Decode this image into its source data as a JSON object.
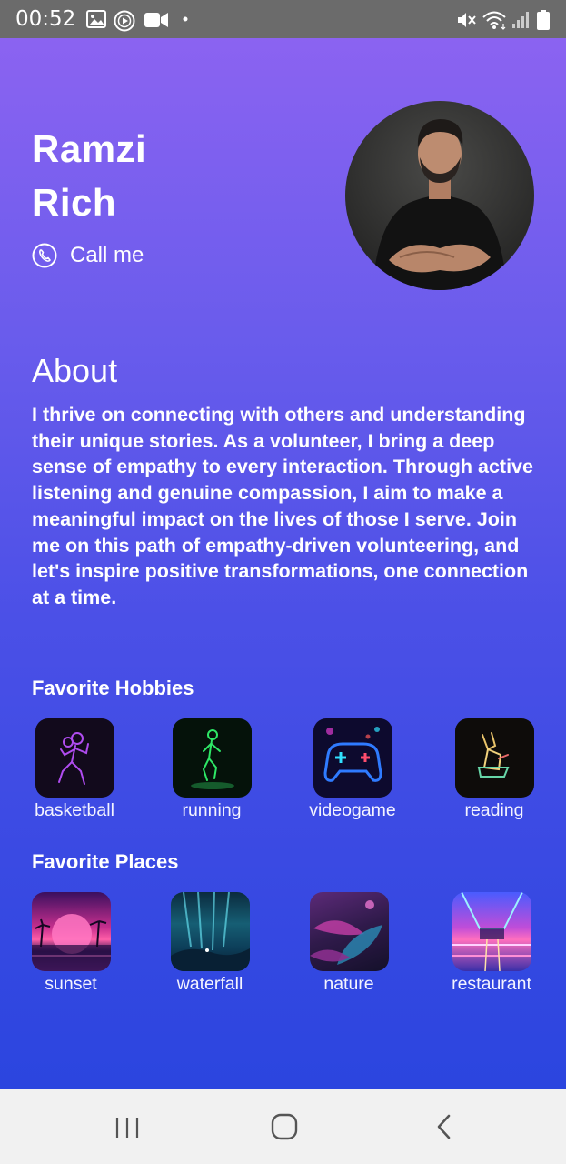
{
  "status_bar": {
    "time": "00:52",
    "left_icons": [
      "image-icon",
      "play-circle-icon",
      "video-camera-icon",
      "dot-icon"
    ],
    "right_icons": [
      "mute-icon",
      "wifi-icon",
      "signal-icon",
      "battery-icon"
    ]
  },
  "profile": {
    "first_name": "Ramzi",
    "last_name": "Rich",
    "call_label": "Call me"
  },
  "about": {
    "title": "About",
    "text": "I thrive on connecting with others and understanding their unique stories. As a volunteer, I bring a deep sense of empathy to every interaction. Through active listening and genuine compassion, I aim to make a meaningful impact on the lives of those I serve. Join me on this path of empathy-driven volunteering, and let's inspire positive transformations, one connection at a time."
  },
  "hobbies": {
    "title": "Favorite Hobbies",
    "items": [
      {
        "label": "basketball"
      },
      {
        "label": "running"
      },
      {
        "label": "videogame"
      },
      {
        "label": "reading"
      }
    ]
  },
  "places": {
    "title": "Favorite Places",
    "items": [
      {
        "label": "sunset"
      },
      {
        "label": "waterfall"
      },
      {
        "label": "nature"
      },
      {
        "label": "restaurant"
      }
    ]
  },
  "nav_bar": {
    "icons": [
      "recent-apps-icon",
      "home-icon",
      "back-icon"
    ]
  }
}
